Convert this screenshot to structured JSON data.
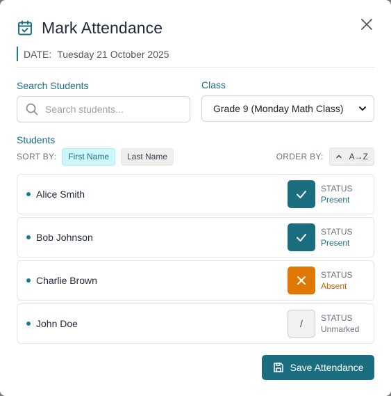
{
  "modal": {
    "title": "Mark Attendance",
    "date_label": "DATE:",
    "date_value": "Tuesday 21 October 2025"
  },
  "search": {
    "label": "Search Students",
    "placeholder": "Search students..."
  },
  "class_select": {
    "label": "Class",
    "selected": "Grade 9 (Monday Math Class)"
  },
  "students_section": {
    "label": "Students",
    "sort_by_label": "SORT BY:",
    "sort_options": [
      "First Name",
      "Last Name"
    ],
    "active_sort": "First Name",
    "order_by_label": "ORDER BY:",
    "order_value": "A→Z"
  },
  "students": [
    {
      "name": "Alice Smith",
      "status_caption": "STATUS",
      "status": "Present"
    },
    {
      "name": "Bob Johnson",
      "status_caption": "STATUS",
      "status": "Present"
    },
    {
      "name": "Charlie Brown",
      "status_caption": "STATUS",
      "status": "Absent"
    },
    {
      "name": "John Doe",
      "status_caption": "STATUS",
      "status": "Unmarked",
      "status_symbol": "/"
    }
  ],
  "actions": {
    "save_label": "Save Attendance"
  },
  "icons": {
    "header": "calendar-check-icon",
    "close": "close-icon",
    "search": "search-icon",
    "select": "chevron-down-icon",
    "order": "chevron-up-icon",
    "present": "check-icon",
    "absent": "x-icon",
    "save": "save-icon"
  },
  "colors": {
    "accent": "#1b6d80",
    "absent": "#e07700",
    "active_chip_bg": "#cff7fb"
  }
}
